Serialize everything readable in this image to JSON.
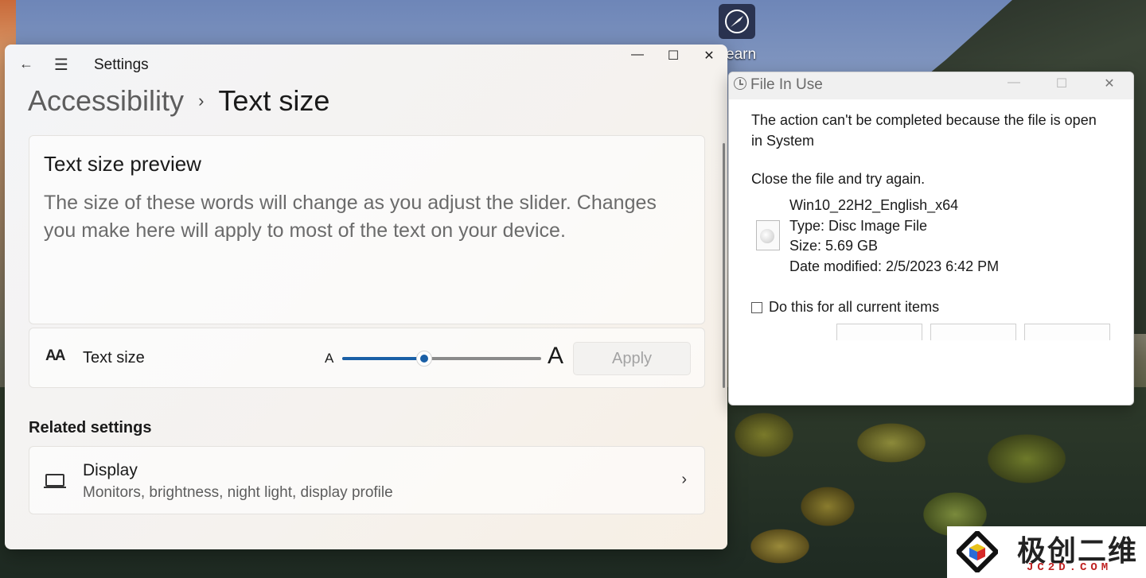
{
  "desktop": {
    "shortcut_label": "earn"
  },
  "settings": {
    "app_title": "Settings",
    "window_controls": {
      "minimize": "—",
      "maximize": "☐",
      "close": "✕"
    },
    "breadcrumb": {
      "parent": "Accessibility",
      "separator": "›",
      "current": "Text size"
    },
    "preview": {
      "title": "Text size preview",
      "text": "The size of these words will change as you adjust the slider. Changes you make here will apply to most of the text on your device."
    },
    "text_size": {
      "label": "Text size",
      "icon_glyph": "AA",
      "small_marker": "A",
      "large_marker": "A",
      "slider_value_fraction": 0.41,
      "apply_label": "Apply"
    },
    "related_heading": "Related settings",
    "display": {
      "title": "Display",
      "subtitle": "Monitors, brightness, night light, display profile",
      "chevron": "›"
    }
  },
  "dialog": {
    "title": "File In Use",
    "controls": {
      "minimize": "—",
      "maximize": "☐",
      "close": "✕"
    },
    "message": "The action can't be completed because the file is open in System",
    "instruction": "Close the file and try again.",
    "file": {
      "name": "Win10_22H2_English_x64",
      "type": "Type: Disc Image File",
      "size": "Size: 5.69 GB",
      "modified": "Date modified: 2/5/2023 6:42 PM"
    },
    "checkbox_label": "Do this for all current items",
    "checkbox_checked": false
  },
  "watermark": {
    "chinese": "极创二维",
    "domain": "JC2D.COM"
  },
  "colors": {
    "accent": "#1a5fa6",
    "watermark_red": "#c02424"
  }
}
